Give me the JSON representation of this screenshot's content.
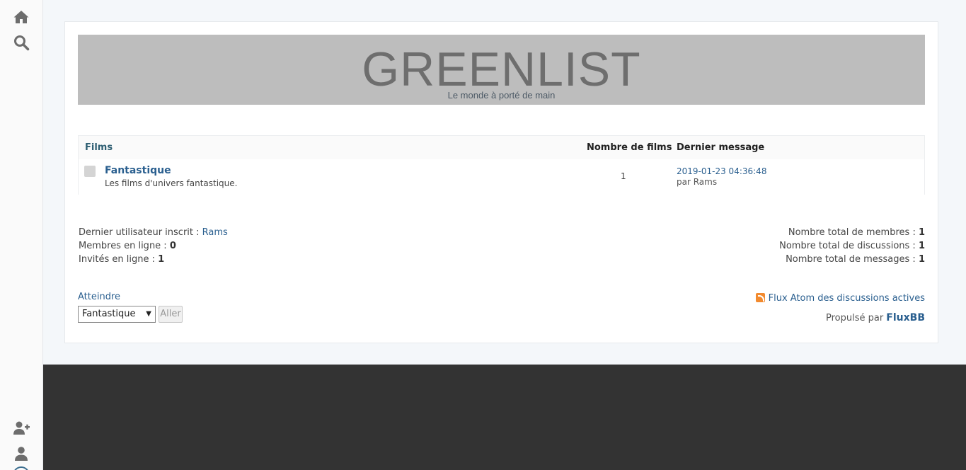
{
  "sidebar": {
    "icons": [
      "home-icon",
      "search-icon",
      "user-plus-icon",
      "user-icon"
    ]
  },
  "banner": {
    "title": "GREENLIST",
    "description": "Le monde à porté de main"
  },
  "forum_table": {
    "headers": {
      "category": "Films",
      "count": "Nombre de films",
      "last_post": "Dernier message"
    },
    "rows": [
      {
        "name": "Fantastique",
        "description": "Les films d'univers fantastique.",
        "count": "1",
        "last_post_date": "2019-01-23 04:36:48",
        "last_post_by": "par Rams"
      }
    ]
  },
  "stats": {
    "left": {
      "newest_user_label": "Dernier utilisateur inscrit : ",
      "newest_user": "Rams",
      "online_members_label": "Membres en ligne : ",
      "online_members": "0",
      "online_guests_label": "Invités en ligne : ",
      "online_guests": "1"
    },
    "right": {
      "total_members_label": "Nombre total de membres : ",
      "total_members": "1",
      "total_topics_label": "Nombre total de discussions : ",
      "total_topics": "1",
      "total_posts_label": "Nombre total de messages : ",
      "total_posts": "1"
    }
  },
  "jump": {
    "label": "Atteindre",
    "selected": "Fantastique",
    "button": "Aller"
  },
  "footer": {
    "feed_label": "Flux Atom des discussions actives",
    "powered_label": "Propulsé par ",
    "powered_link": "FluxBB"
  },
  "colors": {
    "link": "#2a5f8f",
    "banner_bg": "#bdbdbd",
    "dark_footer": "#333333"
  }
}
